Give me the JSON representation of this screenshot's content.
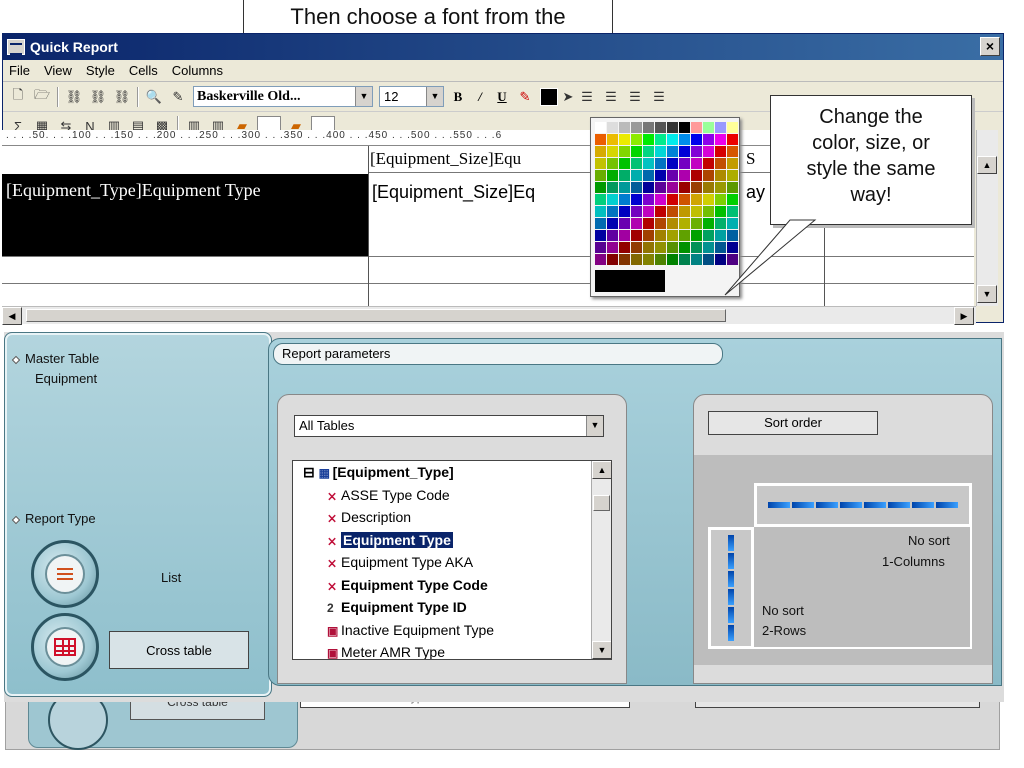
{
  "top_callout": "Then choose a font from the",
  "window": {
    "title": "Quick Report",
    "close": "×"
  },
  "menu": [
    "File",
    "View",
    "Style",
    "Cells",
    "Columns"
  ],
  "toolbar": {
    "font_name": "Baskerville Old...",
    "font_size": "12",
    "bold": "B",
    "italic": "/",
    "underline": "U"
  },
  "ruler": " . . . .50. . . .100 . . .150 . . .200 . . .250 . . .300 . . .350 . . .400 . . .450 . . .500 . . .550 . . .6",
  "grid": {
    "header_cell": "[Equipment_Size]Equ",
    "header_cell_right": "S",
    "type_cell": "[Equipment_Type]Equipment Type",
    "size_cell": "[Equipment_Size]Eq",
    "trail_cell": "ay S"
  },
  "callout_right": [
    "Change the",
    "color, size, or",
    "style the same",
    "way!"
  ],
  "ghost": {
    "label": "Cross table",
    "strip": "Meter AMR Type"
  },
  "dialog": {
    "master_label": "Master Table",
    "master_value": "Equipment",
    "report_type_label": "Report Type",
    "list_label": "List",
    "cross_table_label": "Cross table",
    "params_tab": "Report parameters",
    "tables_select": "All Tables",
    "tree": [
      {
        "label": "[Equipment_Type]",
        "icon": "table-icon",
        "bold": true,
        "root": true
      },
      {
        "label": "ASSE Type Code",
        "icon": "field-icon"
      },
      {
        "label": "Description",
        "icon": "field-icon"
      },
      {
        "label": "Equipment Type",
        "icon": "field-icon",
        "bold": true,
        "selected": true
      },
      {
        "label": "Equipment Type AKA",
        "icon": "field-icon"
      },
      {
        "label": "Equipment Type Code",
        "icon": "field-icon",
        "bold": true
      },
      {
        "label": "Equipment Type ID",
        "icon": "number-icon",
        "bold": true
      },
      {
        "label": "Inactive Equipment Type",
        "icon": "boolean-icon"
      },
      {
        "label": "Meter AMR Type",
        "icon": "boolean-icon"
      }
    ],
    "sort_tab": "Sort order",
    "col_sort": "No sort",
    "col_count": "1-Columns",
    "row_sort": "No sort",
    "row_count": "2-Rows"
  }
}
